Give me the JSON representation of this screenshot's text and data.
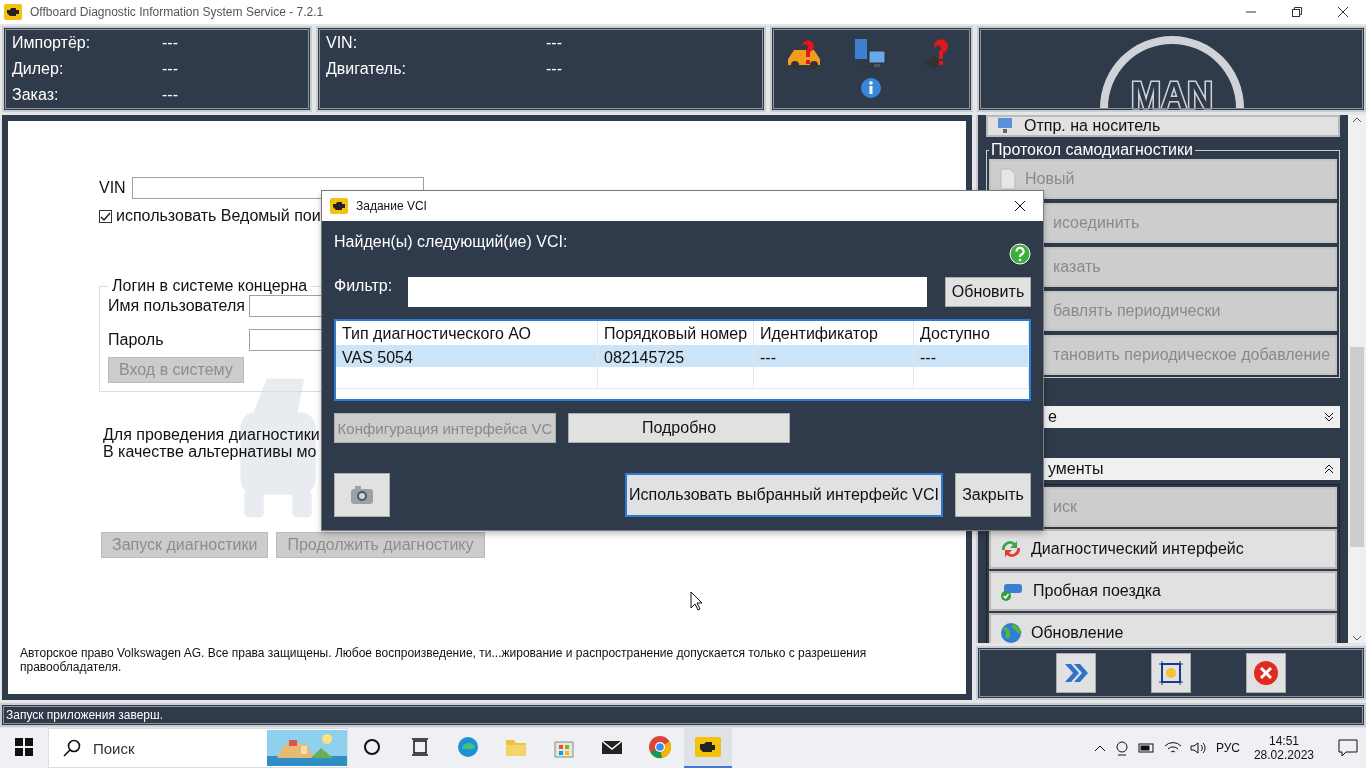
{
  "window": {
    "title": "Offboard Diagnostic Information System Service - 7.2.1"
  },
  "header": {
    "info_left": [
      {
        "label": "Импортёр:",
        "value": "---"
      },
      {
        "label": "Дилер:",
        "value": "---"
      },
      {
        "label": "Заказ:",
        "value": "---"
      }
    ],
    "info_right": [
      {
        "label": "VIN:",
        "value": "---"
      },
      {
        "label": "Двигатель:",
        "value": "---"
      }
    ],
    "logo": "MAN"
  },
  "main": {
    "vin_label": "VIN",
    "slave_checkbox": {
      "label": "использовать Ведомый пои",
      "checked": true
    },
    "login": {
      "title": "Логин в системе концерна",
      "username_label": "Имя пользователя",
      "password_label": "Пароль",
      "login_button": {
        "label": "Вход в систему",
        "disabled": true
      }
    },
    "info_lines": [
      "Для проведения диагностики",
      "В качестве альтернативы мо"
    ],
    "buttons": [
      {
        "label": "Запуск диагностики",
        "disabled": true
      },
      {
        "label": "Продолжить диагностику",
        "disabled": true
      }
    ],
    "copyright": "Авторское право Volkswagen AG. Все права защищены. Любое воспроизведение, ти...жирование и распространение допускается только с разрешения правообладателя."
  },
  "sidebar": {
    "top_button": {
      "label": "Отпр. на носитель",
      "kind": "media"
    },
    "protocol": {
      "title": "Протокол самодиагностики",
      "items": [
        {
          "label": "Новый",
          "kind": "document",
          "disabled": true
        },
        {
          "label": "исоединить",
          "kind": "covered",
          "disabled": true
        },
        {
          "label": "казать",
          "kind": "covered",
          "disabled": true
        },
        {
          "label": "бавлять периодически",
          "kind": "covered",
          "disabled": true
        },
        {
          "label": "тановить периодическое добавление",
          "kind": "covered",
          "disabled": true
        }
      ]
    },
    "sections": [
      {
        "title": "е",
        "expanded": false
      },
      {
        "title": "ументы",
        "expanded": true,
        "items": [
          {
            "label": "иск",
            "kind": "covered",
            "disabled": true
          },
          {
            "label": "Диагностический интерфейс",
            "kind": "interface",
            "disabled": false
          },
          {
            "label": "Пробная поездка",
            "kind": "test-drive",
            "disabled": false
          },
          {
            "label": "Обновление",
            "kind": "update",
            "disabled": false
          }
        ]
      }
    ]
  },
  "dialog": {
    "title": "Задание VCI",
    "heading": "Найден(ы) следующий(ие) VCI:",
    "filter_label": "Фильтр:",
    "refresh_button": "Обновить",
    "table": {
      "columns": [
        "Тип диагностического АО",
        "Порядковый номер",
        "Идентификатор",
        "Доступно"
      ],
      "rows": [
        {
          "cells": [
            "VAS 5054",
            "082145725",
            "---",
            "---"
          ],
          "selected": true
        }
      ]
    },
    "buttons": [
      {
        "label": "Конфигурация интерфейса VC",
        "disabled": true
      },
      {
        "label": "Подробно",
        "disabled": false
      }
    ],
    "use_button": {
      "label": "Использовать выбранный интерфейс VCI",
      "focused": true
    },
    "close_button": "Закрыть"
  },
  "status_bar": "Запуск приложения заверш.",
  "taskbar": {
    "search_placeholder": "Поиск",
    "apps": [
      {
        "kind": "cortana",
        "active": false
      },
      {
        "kind": "task-view",
        "active": false
      },
      {
        "kind": "browser",
        "active": false
      },
      {
        "kind": "folder",
        "active": false
      },
      {
        "kind": "store",
        "active": false
      },
      {
        "kind": "mail",
        "active": false
      },
      {
        "kind": "chrome",
        "active": false
      },
      {
        "kind": "odis",
        "active": true
      }
    ],
    "language": "РУС",
    "time": "14:51",
    "date": "28.02.2023"
  }
}
